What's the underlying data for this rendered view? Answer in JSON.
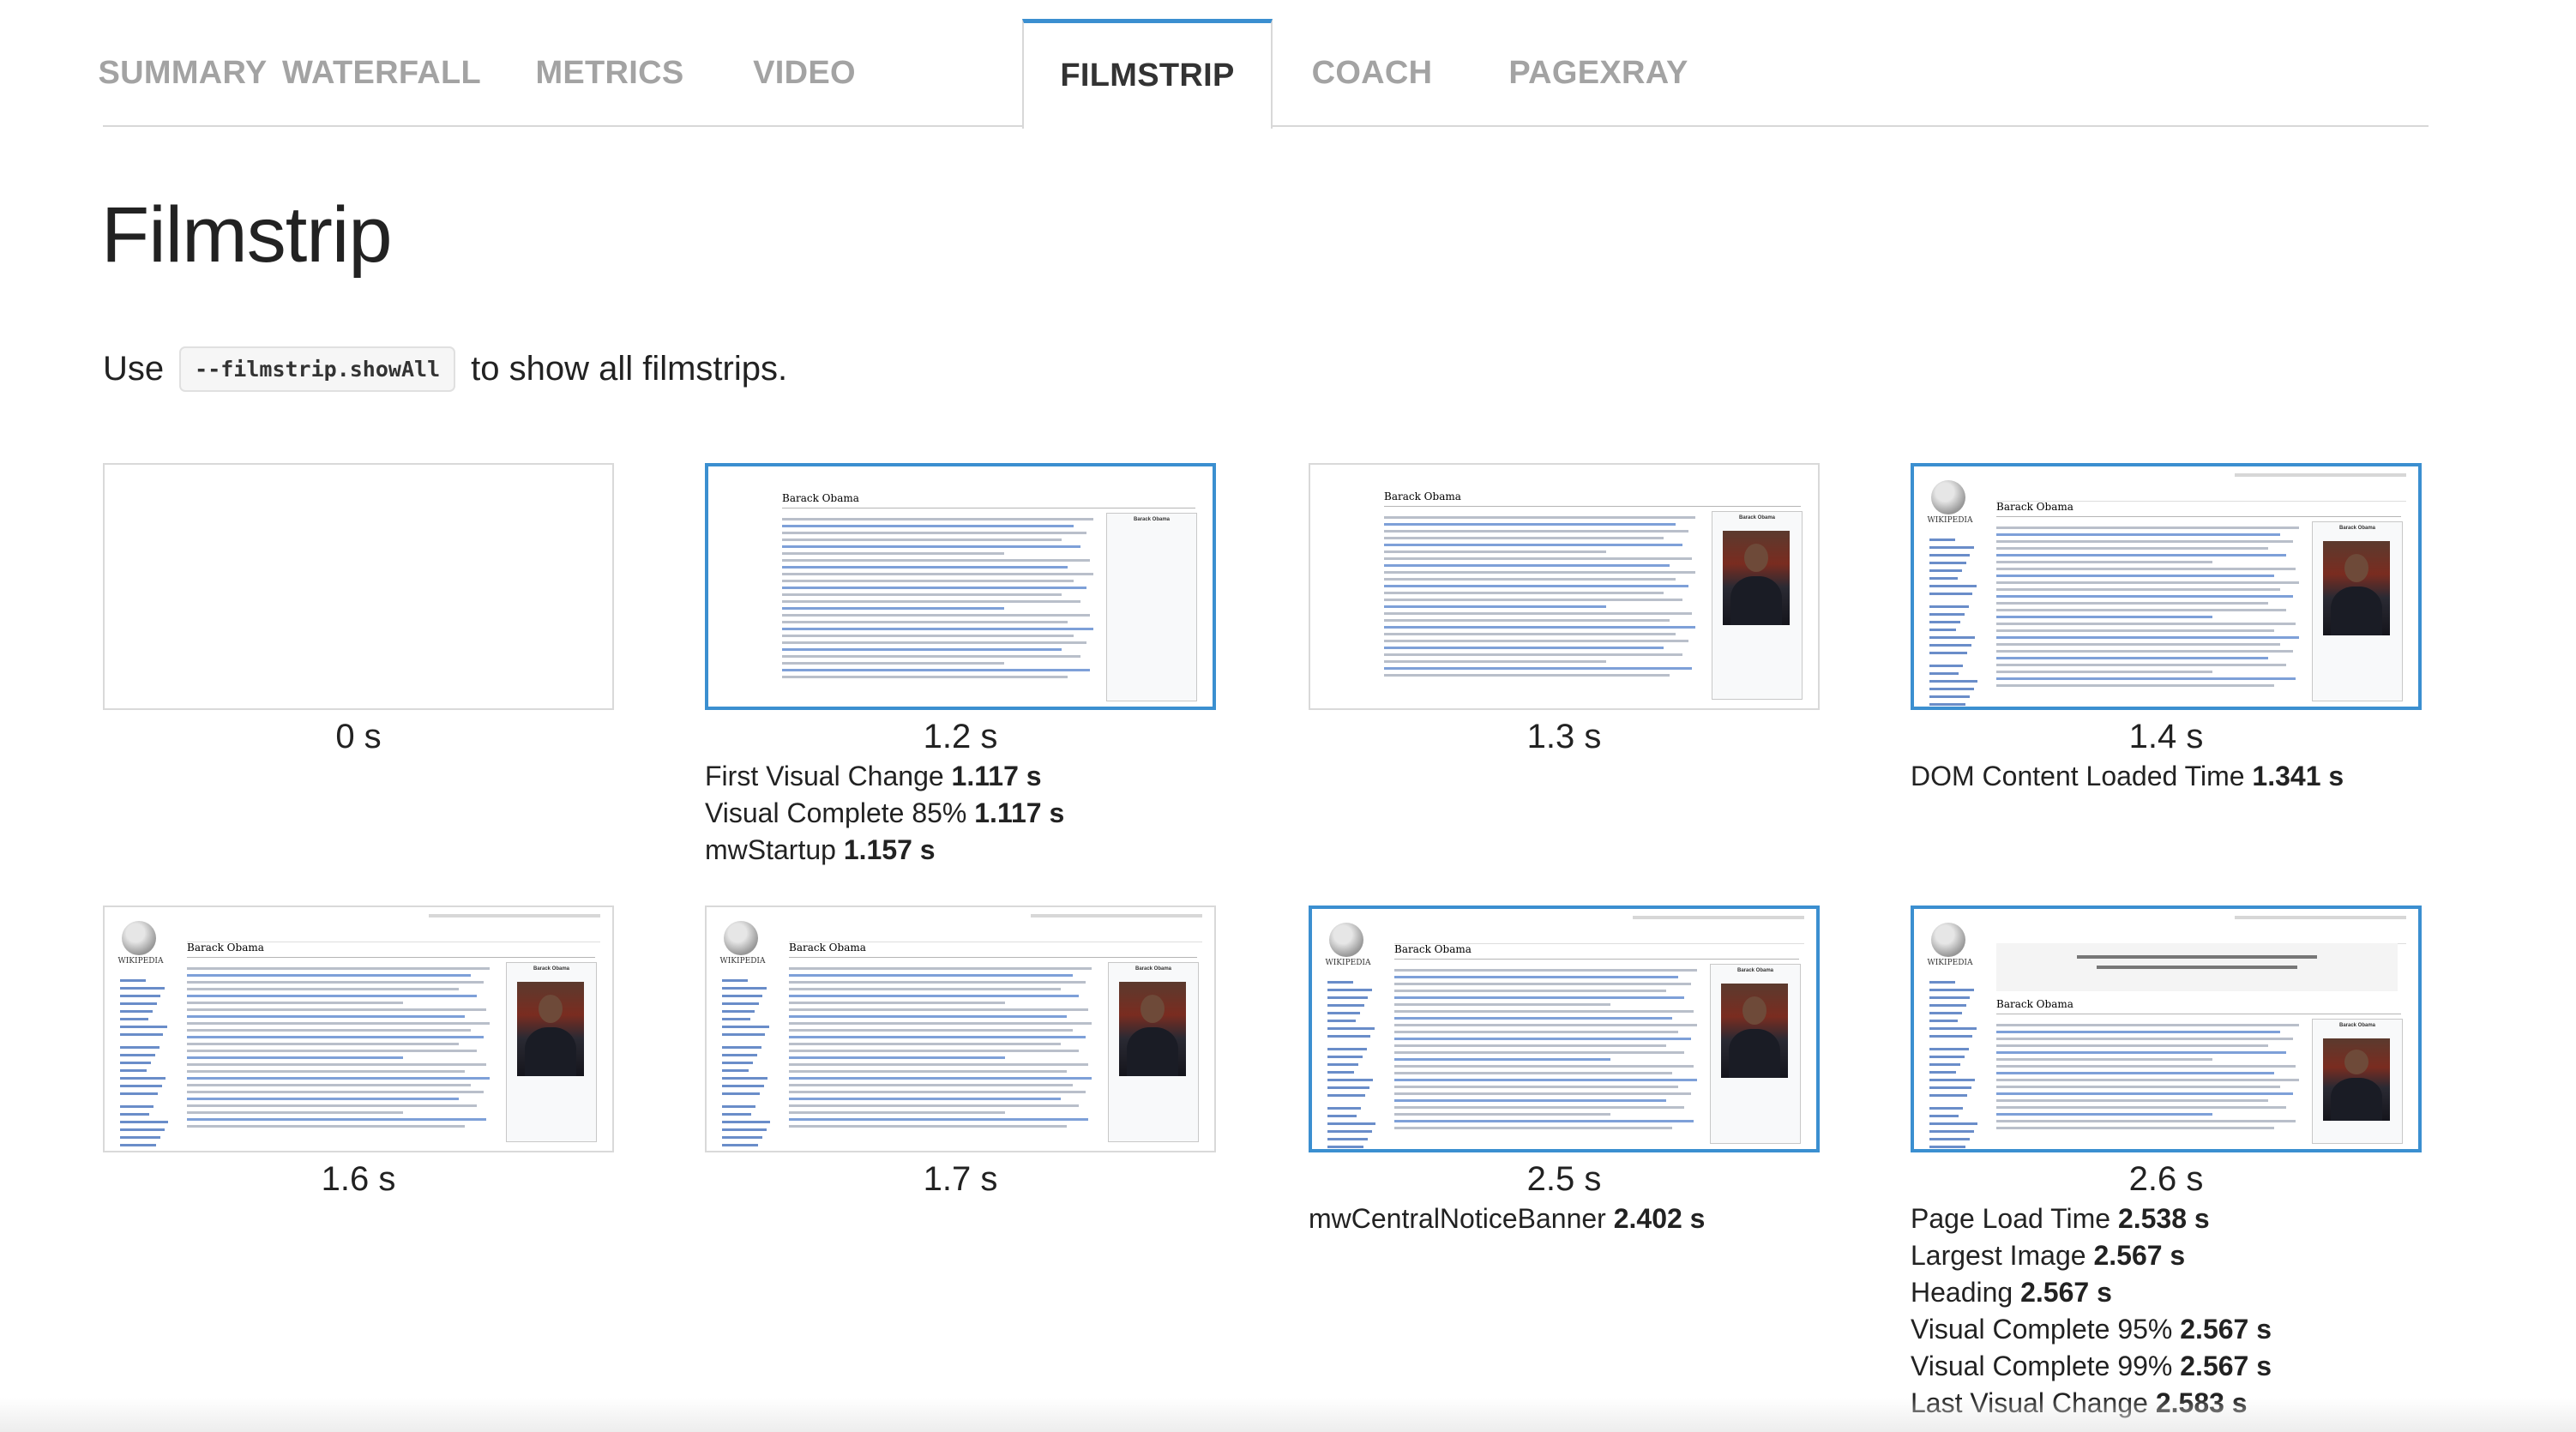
{
  "tabs": [
    {
      "label": "SUMMARY",
      "active": false
    },
    {
      "label": "WATERFALL",
      "active": false
    },
    {
      "label": "METRICS",
      "active": false
    },
    {
      "label": "VIDEO",
      "active": false
    },
    {
      "label": "FILMSTRIP",
      "active": true
    },
    {
      "label": "COACH",
      "active": false
    },
    {
      "label": "PAGEXRAY",
      "active": false
    }
  ],
  "page": {
    "title": "Filmstrip",
    "hint_prefix": "Use",
    "hint_code": "--filmstrip.showAll",
    "hint_suffix": "to show all filmstrips."
  },
  "frames": [
    {
      "time": "0 s",
      "state": "blank",
      "changed": false,
      "metrics": []
    },
    {
      "time": "1.2 s",
      "state": "article",
      "changed": true,
      "metrics": [
        {
          "name": "First Visual Change",
          "value": "1.117 s"
        },
        {
          "name": "Visual Complete 85%",
          "value": "1.117 s"
        },
        {
          "name": "mwStartup",
          "value": "1.157 s"
        }
      ]
    },
    {
      "time": "1.3 s",
      "state": "article-photo",
      "changed": false,
      "metrics": []
    },
    {
      "time": "1.4 s",
      "state": "full",
      "changed": true,
      "metrics": [
        {
          "name": "DOM Content Loaded Time",
          "value": "1.341 s"
        }
      ]
    },
    {
      "time": "1.6 s",
      "state": "full",
      "changed": false,
      "metrics": []
    },
    {
      "time": "1.7 s",
      "state": "full",
      "changed": false,
      "metrics": []
    },
    {
      "time": "2.5 s",
      "state": "full",
      "changed": true,
      "metrics": [
        {
          "name": "mwCentralNoticeBanner",
          "value": "2.402 s"
        }
      ]
    },
    {
      "time": "2.6 s",
      "state": "banner",
      "changed": true,
      "metrics": [
        {
          "name": "Page Load Time",
          "value": "2.538 s"
        },
        {
          "name": "Largest Image",
          "value": "2.567 s"
        },
        {
          "name": "Heading",
          "value": "2.567 s"
        },
        {
          "name": "Visual Complete 95%",
          "value": "2.567 s"
        },
        {
          "name": "Visual Complete 99%",
          "value": "2.567 s"
        },
        {
          "name": "Last Visual Change",
          "value": "2.583 s"
        }
      ]
    }
  ],
  "thumbnail_content": {
    "article_title": "Barack Obama",
    "logo_word": "WIKIPEDIA",
    "infobox_caption": "Barack Obama"
  },
  "colors": {
    "accent": "#3b8fd0",
    "tab_inactive": "#a3a3a3",
    "tab_active": "#333333",
    "border": "#d8d8d8"
  }
}
